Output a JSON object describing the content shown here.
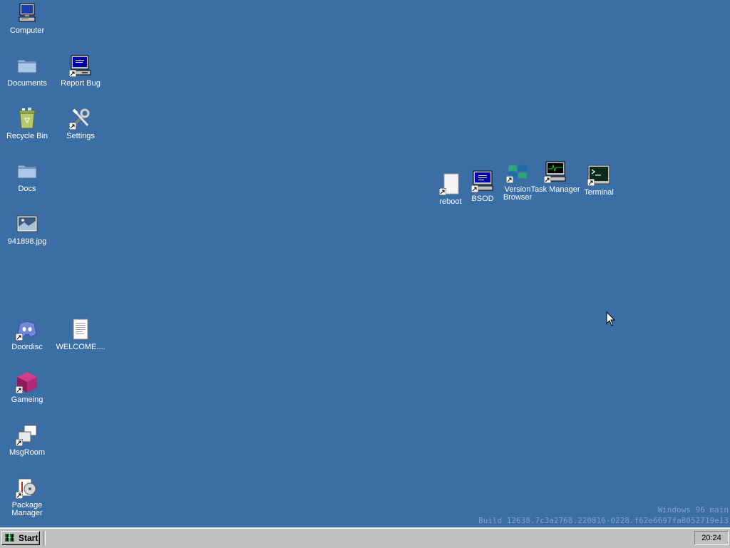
{
  "desktop": {
    "background": "#3a6ea5",
    "icons": [
      {
        "id": "computer",
        "label": "Computer",
        "icon": "computer-icon"
      },
      {
        "id": "documents",
        "label": "Documents",
        "icon": "folder-icon"
      },
      {
        "id": "report-bug",
        "label": "Report Bug",
        "icon": "computer-icon"
      },
      {
        "id": "recycle-bin",
        "label": "Recycle Bin",
        "icon": "recycle-bin-icon"
      },
      {
        "id": "settings",
        "label": "Settings",
        "icon": "tools-icon"
      },
      {
        "id": "docs",
        "label": "Docs",
        "icon": "folder-icon"
      },
      {
        "id": "image-file",
        "label": "941898.jpg",
        "icon": "image-file-icon"
      },
      {
        "id": "doordisc",
        "label": "Doordisc",
        "icon": "discord-icon"
      },
      {
        "id": "welcome",
        "label": "WELCOME....",
        "icon": "text-document-icon"
      },
      {
        "id": "gameing",
        "label": "Gameing",
        "icon": "cube-icon"
      },
      {
        "id": "msgroom",
        "label": "MsgRoom",
        "icon": "chat-windows-icon"
      },
      {
        "id": "package-manager",
        "label": "Package Manager",
        "icon": "package-icon"
      },
      {
        "id": "reboot",
        "label": "reboot",
        "icon": "blank-file-icon"
      },
      {
        "id": "bsod",
        "label": "BSOD",
        "icon": "computer-icon"
      },
      {
        "id": "version-browser",
        "label": "Version Browser",
        "icon": "windows-flag-icon"
      },
      {
        "id": "task-manager",
        "label": "Task Manager",
        "icon": "task-manager-icon"
      },
      {
        "id": "terminal",
        "label": "Terminal",
        "icon": "terminal-icon"
      }
    ]
  },
  "watermark": {
    "line1": "Windows 96 main",
    "line2": "Build 12638.7c3a2768.220816-0228.f62e6697fa8052719e13"
  },
  "taskbar": {
    "start_label": "Start",
    "clock": "20:24"
  }
}
